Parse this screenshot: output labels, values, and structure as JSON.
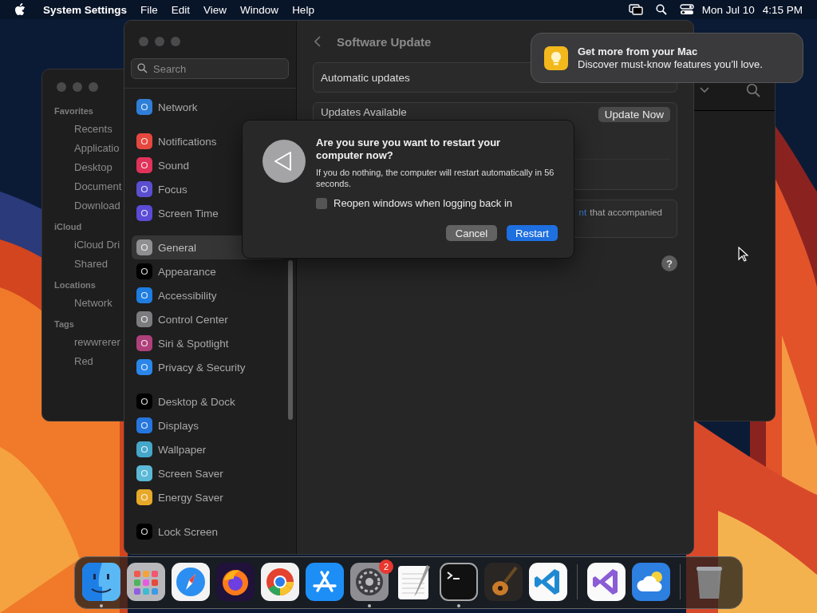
{
  "menu_bar": {
    "app_name": "System Settings",
    "menus": [
      "File",
      "Edit",
      "View",
      "Window",
      "Help"
    ],
    "date": "Mon Jul 10",
    "time": "4:15 PM"
  },
  "finder_window": {
    "sidebar": [
      {
        "heading": "Favorites",
        "items": [
          "Recents",
          "Applicatio",
          "Desktop",
          "Document",
          "Download"
        ]
      },
      {
        "heading": "iCloud",
        "items": [
          "iCloud Dri",
          "Shared"
        ]
      },
      {
        "heading": "Locations",
        "items": [
          "Network"
        ]
      },
      {
        "heading": "Tags",
        "items": [
          "rewwrerer",
          "Red"
        ]
      }
    ]
  },
  "settings_window": {
    "search": {
      "placeholder": "Search"
    },
    "sidebar": [
      [
        {
          "label": "Network",
          "color": "#2f7fd8",
          "selected": false
        }
      ],
      [
        {
          "label": "Notifications",
          "color": "#e5483f",
          "selected": false
        },
        {
          "label": "Sound",
          "color": "#e0335a",
          "selected": false
        },
        {
          "label": "Focus",
          "color": "#5a4fd0",
          "selected": false
        },
        {
          "label": "Screen Time",
          "color": "#5b4bd6",
          "selected": false
        }
      ],
      [
        {
          "label": "General",
          "color": "#8e8e93",
          "selected": true
        },
        {
          "label": "Appearance",
          "color": "#000000",
          "selected": false
        },
        {
          "label": "Accessibility",
          "color": "#1f7de0",
          "selected": false
        },
        {
          "label": "Control Center",
          "color": "#7c7c80",
          "selected": false
        },
        {
          "label": "Siri & Spotlight",
          "color": "#b0407a",
          "selected": false
        },
        {
          "label": "Privacy & Security",
          "color": "#2a86e8",
          "selected": false
        }
      ],
      [
        {
          "label": "Desktop & Dock",
          "color": "#000000",
          "selected": false
        },
        {
          "label": "Displays",
          "color": "#2677dd",
          "selected": false
        },
        {
          "label": "Wallpaper",
          "color": "#45a7c9",
          "selected": false
        },
        {
          "label": "Screen Saver",
          "color": "#5bb8d6",
          "selected": false
        },
        {
          "label": "Energy Saver",
          "color": "#e7a92a",
          "selected": false
        }
      ],
      [
        {
          "label": "Lock Screen",
          "color": "#000000",
          "selected": false
        }
      ]
    ],
    "title": "Software Update",
    "automatic_updates": "Automatic updates",
    "updates_available": {
      "label": "Updates Available",
      "button": "Update Now"
    },
    "note": {
      "link": "nt",
      "text": "that accompanied"
    },
    "help": "?"
  },
  "dialog": {
    "title": "Are you sure you want to restart your computer now?",
    "message": "If you do nothing, the computer will restart automatically in 56 seconds.",
    "checkbox": {
      "label": "Reopen windows when logging back in",
      "checked": false
    },
    "buttons": [
      {
        "label": "Cancel",
        "default": false
      },
      {
        "label": "Restart",
        "default": true
      }
    ]
  },
  "notification": {
    "title": "Get more from your Mac",
    "body": "Discover must-know features you’ll love."
  },
  "dock": {
    "apps": [
      {
        "kind": "finder",
        "running": true
      },
      {
        "kind": "launchpad",
        "running": false
      },
      {
        "kind": "safari",
        "running": false
      },
      {
        "kind": "firefox",
        "running": false
      },
      {
        "kind": "chrome",
        "running": false
      },
      {
        "kind": "appstore",
        "running": false
      },
      {
        "kind": "settings",
        "running": true,
        "badge": "2"
      },
      {
        "kind": "textedit",
        "running": false
      },
      {
        "kind": "terminal",
        "running": true
      },
      {
        "kind": "guitar",
        "running": false
      },
      {
        "kind": "vscode",
        "running": false
      },
      {
        "kind": "separator"
      },
      {
        "kind": "visualstudio",
        "running": false
      },
      {
        "kind": "weather",
        "running": false
      },
      {
        "kind": "separator"
      },
      {
        "kind": "trash",
        "running": false
      }
    ]
  }
}
